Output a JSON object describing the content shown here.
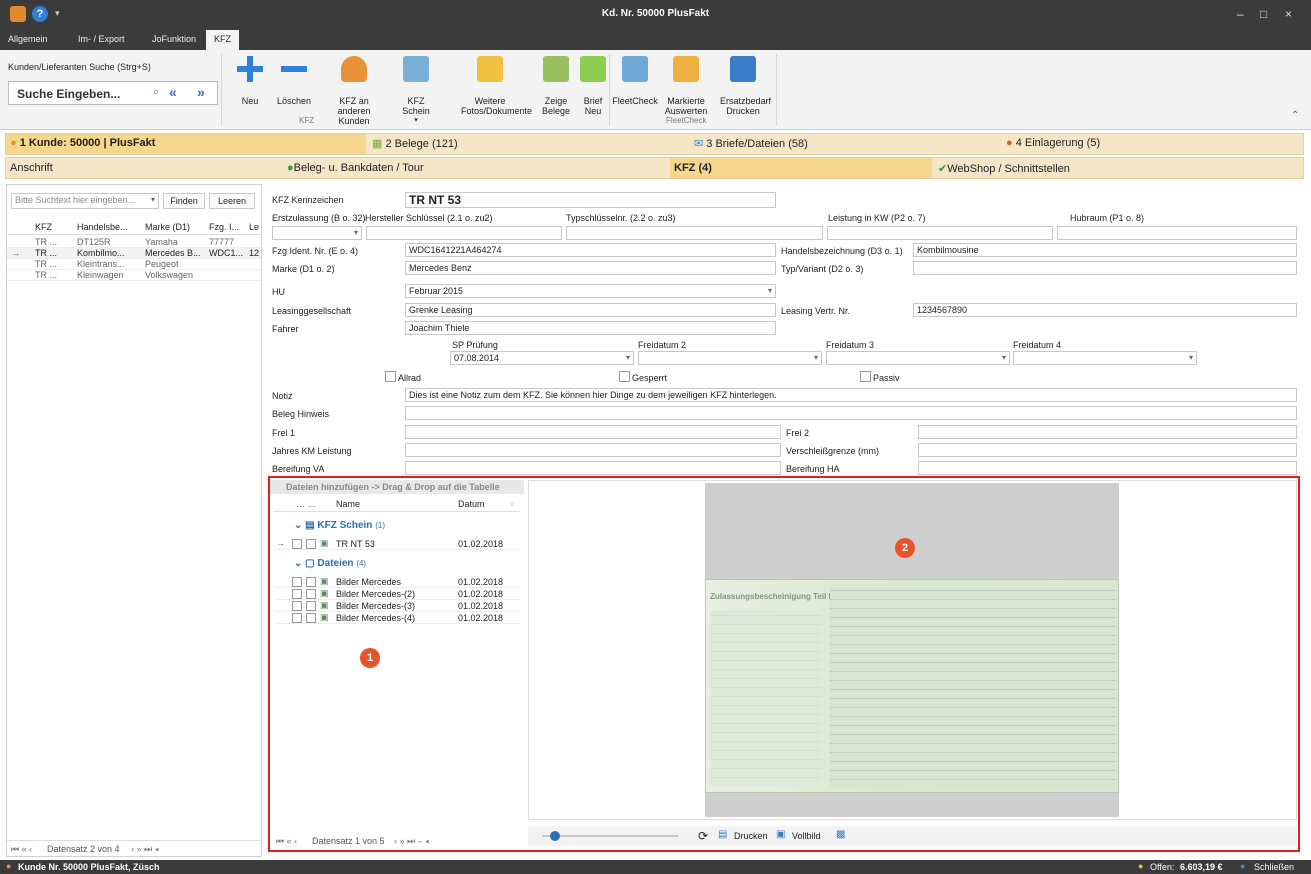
{
  "window": {
    "title": "Kd. Nr. 50000 PlusFakt",
    "minimize": "–",
    "maximize": "□",
    "close": "×"
  },
  "menu": [
    "Allgemein",
    "Im- / Export",
    "JoFunktion",
    "KFZ"
  ],
  "ribbon": {
    "search_label": "Kunden/Lieferanten Suche (Strg+S)",
    "search_placeholder": "Suche Eingeben...",
    "buttons": [
      "Neu",
      "Löschen",
      "KFZ an anderen Kunden",
      "KFZ Schein",
      "Weitere Fotos/Dokumente",
      "Zeige Belege",
      "Brief Neu",
      "FleetCheck",
      "Markierte Auswerten",
      "Ersatzbedarf Drucken"
    ],
    "groups": [
      "KFZ",
      "FleetCheck"
    ]
  },
  "tabs1": [
    "1 Kunde: 50000 | PlusFakt",
    "2 Belege (121)",
    "3 Briefe/Dateien (58)",
    "4 Einlagerung (5)"
  ],
  "tabs2": [
    "Anschrift",
    "Beleg- u. Bankdaten / Tour",
    "KFZ (4)",
    "WebShop / Schnittstellen"
  ],
  "left": {
    "search_placeholder": "Bitte Suchtext hier eingeben...",
    "find": "Finden",
    "clear": "Leeren",
    "cols": [
      "KFZ",
      "Handelsbe...",
      "Marke (D1)",
      "Fzg. I...",
      "Le"
    ],
    "rows": [
      [
        "TR ...",
        "DT125R",
        "Yamaha",
        "77777"
      ],
      [
        "TR ...",
        "Kombilmo...",
        "Mercedes B...",
        "WDC1...",
        "12"
      ],
      [
        "TR ...",
        "Kleintrans...",
        "Peugeot",
        ""
      ],
      [
        "TR ...",
        "Kleinwagen",
        "Volkswagen",
        ""
      ]
    ],
    "footer": "Datensatz 2 von 4"
  },
  "form": {
    "kennzeichen_label": "KFZ Kennzeichen",
    "kennzeichen": "TR NT 53",
    "erstzulassung": "Erstzulassung (B o. 32)",
    "hersteller": "Hersteller Schlüssel (2.1 o. zu2)",
    "typschl": "Typschlüsselnr. (2.2 o. zu3)",
    "leistung": "Leistung in KW (P2 o. 7)",
    "hubraum": "Hubraum (P1 o. 8)",
    "fzg_label": "Fzg Ident. Nr. (E o. 4)",
    "fzg": "WDC1641221A464274",
    "handels_label": "Handelsbezeichnung (D3 o. 1)",
    "handels": "Kombilmousine",
    "marke_label": "Marke (D1 o. 2)",
    "marke": "Mercedes Benz",
    "typ_label": "Typ/Variant (D2 o. 3)",
    "hu_label": "HU",
    "hu": "Februar 2015",
    "leasing_label": "Leasinggesellschaft",
    "leasing": "Grenke Leasing",
    "leasingnr_label": "Leasing Vertr. Nr.",
    "leasingnr": "1234567890",
    "fahrer_label": "Fahrer",
    "fahrer": "Joachim Thiele",
    "sp_label": "SP Prüfung",
    "sp": "07.08.2014",
    "frei2": "Freidatum 2",
    "frei3": "Freidatum 3",
    "frei4": "Freidatum 4",
    "allrad": "Allrad",
    "gesperrt": "Gesperrt",
    "passiv": "Passiv",
    "notiz_label": "Notiz",
    "notiz": "Dies ist eine Notiz zum dem KFZ. Sie können hier Dinge zu dem jeweiligen KFZ hinterlegen.",
    "beleg_label": "Beleg Hinweis",
    "frei1_label": "Frei 1",
    "frei2_label": "Frei 2",
    "jkm_label": "Jahres KM Leistung",
    "vgrenze_label": "Verschleißgrenze (mm)",
    "bva_label": "Bereifung VA",
    "bha_label": "Bereifung HA"
  },
  "files": {
    "header": "Dateien hinzufügen -> Drag & Drop auf die Tabelle",
    "col_name": "Name",
    "col_datum": "Datum",
    "group1": "KFZ Schein",
    "group1_count": "(1)",
    "g1rows": [
      [
        "TR NT 53",
        "01.02.2018"
      ]
    ],
    "group2": "Dateien",
    "group2_count": "(4)",
    "g2rows": [
      [
        "Bilder Mercedes",
        "01.02.2018"
      ],
      [
        "Bilder Mercedes-(2)",
        "01.02.2018"
      ],
      [
        "Bilder Mercedes-(3)",
        "01.02.2018"
      ],
      [
        "Bilder Mercedes-(4)",
        "01.02.2018"
      ]
    ],
    "footer": "Datensatz 1 von 5"
  },
  "preview": {
    "doc_title": "Zulassungsbescheinigung Teil I",
    "print": "Drucken",
    "full": "Vollbild"
  },
  "badges": [
    "1",
    "2"
  ],
  "status": {
    "left": "Kunde Nr. 50000 PlusFakt, Züsch",
    "offen_label": "Offen:",
    "offen": "6.603,19 €",
    "close": "Schließen"
  },
  "colors": {
    "accent": "#e0201a",
    "tab": "#f5e6c8"
  }
}
